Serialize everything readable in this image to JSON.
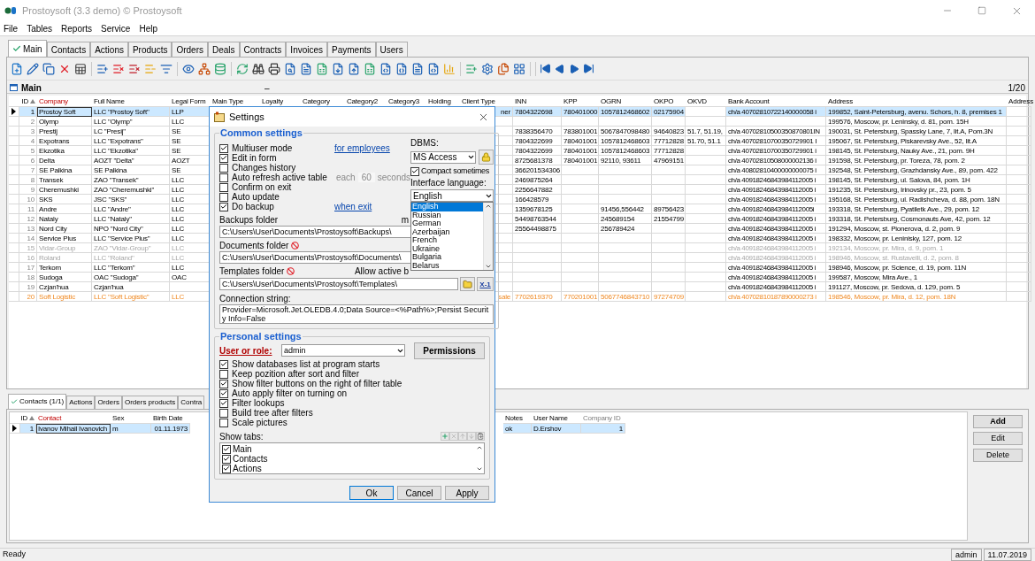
{
  "window": {
    "title": "Prostoysoft (3.3 demo) © Prostoysoft"
  },
  "menu": [
    "File",
    "Tables",
    "Reports",
    "Service",
    "Help"
  ],
  "tabs": [
    {
      "label": "Main",
      "selected": true
    },
    {
      "label": "Contacts",
      "selected": false
    },
    {
      "label": "Actions",
      "selected": false
    },
    {
      "label": "Products",
      "selected": false
    },
    {
      "label": "Orders",
      "selected": false
    },
    {
      "label": "Deals",
      "selected": false
    },
    {
      "label": "Contracts",
      "selected": false
    },
    {
      "label": "Invoices",
      "selected": false
    },
    {
      "label": "Payments",
      "selected": false
    },
    {
      "label": "Users",
      "selected": false
    }
  ],
  "main_panel": {
    "title": "Main",
    "marker": "–",
    "counter": "1/20"
  },
  "table": {
    "columns": [
      {
        "label": "ID",
        "kind": "normal",
        "sorted": true
      },
      {
        "label": "Company",
        "kind": "required",
        "sorted": false
      },
      {
        "label": "Full Name",
        "kind": "normal",
        "sorted": false
      },
      {
        "label": "Legal Form",
        "kind": "normal",
        "sorted": false
      },
      {
        "label": "Main Type",
        "kind": "normal",
        "sorted": false
      },
      {
        "label": "Loyalty",
        "kind": "normal",
        "sorted": false
      },
      {
        "label": "Category",
        "kind": "normal",
        "sorted": false
      },
      {
        "label": "Category2",
        "kind": "normal",
        "sorted": false
      },
      {
        "label": "Category3",
        "kind": "normal",
        "sorted": false
      },
      {
        "label": "Holding",
        "kind": "normal",
        "sorted": false
      },
      {
        "label": "Client Type",
        "kind": "normal",
        "sorted": false
      },
      {
        "label": "INN",
        "kind": "normal",
        "sorted": false
      },
      {
        "label": "KPP",
        "kind": "normal",
        "sorted": false
      },
      {
        "label": "OGRN",
        "kind": "normal",
        "sorted": false
      },
      {
        "label": "OKPO",
        "kind": "normal",
        "sorted": false
      },
      {
        "label": "OKVD",
        "kind": "normal",
        "sorted": false
      },
      {
        "label": "Bank Account",
        "kind": "normal",
        "sorted": false
      },
      {
        "label": "Address",
        "kind": "normal",
        "sorted": false
      },
      {
        "label": "Address",
        "kind": "normal",
        "sorted": false
      }
    ],
    "rows": [
      {
        "selected": true,
        "kind": "normal",
        "id": "1",
        "company": "Prostoy Soft",
        "full_name": "LLC \"Prostoy Soft\"",
        "legal_form": "LLP",
        "client_type": "ner",
        "inn": "7804322698",
        "kpp": "780401000",
        "ogrn": "1057812468602",
        "okpo": "02175904",
        "bank_account": "ch/a 40702810722140000058 i",
        "address": "199852, Saint-Petersburg, avenu. Schors, h. 8, premises 1"
      },
      {
        "selected": false,
        "kind": "normal",
        "id": "2",
        "company": "Olymp",
        "full_name": "LLC \"Olymp\"",
        "legal_form": "LLC",
        "address": "199576, Moscow, pr. Leninsky, d. 81, pom. 15H"
      },
      {
        "selected": false,
        "kind": "normal",
        "id": "3",
        "company": "Prestij",
        "full_name": "LC \"Presij\"",
        "legal_form": "SE",
        "inn": "7838356470",
        "kpp": "783801001",
        "ogrn": "5067847098480",
        "okpo": "94640823",
        "okvd": "51.7, 51.19,",
        "bank_account": "ch/a 40702810500350870801IN",
        "address": "190031, St. Petersburg, Spassky Lane, 7, lit.A, Pom.3N"
      },
      {
        "selected": false,
        "kind": "normal",
        "id": "4",
        "company": "Expotrans",
        "full_name": "LLC \"Expotrans\"",
        "legal_form": "SE",
        "inn": "7804322699",
        "kpp": "780401001",
        "ogrn": "1057812468603",
        "okpo": "77712828",
        "okvd": "51.70, 51.1",
        "bank_account": "ch/a 40702810700350729901 I",
        "address": "195067, St. Petersburg, Piskarevsky Ave., 52, lit.A"
      },
      {
        "selected": false,
        "kind": "normal",
        "id": "5",
        "company": "Ekzotika",
        "full_name": "LLC \"Ekzotika\"",
        "legal_form": "SE",
        "inn": "7804322699",
        "kpp": "780401001",
        "ogrn": "1057812468603",
        "okpo": "77712828",
        "bank_account": "ch/a 40702810700350729901 i",
        "address": "198145, St. Petersburg, Nauky Ave., 21, pom. 9H"
      },
      {
        "selected": false,
        "kind": "normal",
        "id": "6",
        "company": "Delta",
        "full_name": "AOZT \"Delta\"",
        "legal_form": "AOZT",
        "inn": "8725681378",
        "kpp": "780401001",
        "ogrn": "92110, 93611",
        "okpo": "47969151",
        "bank_account": "ch/a 40702810508000002136 i",
        "address": "191598, St. Petersburg, pr. Toreza, 78, pom. 2"
      },
      {
        "selected": false,
        "kind": "normal",
        "id": "7",
        "company": "SE Palkina",
        "full_name": "SE Palkina",
        "legal_form": "SE",
        "inn": "366201534306",
        "bank_account": "ch/a 40802810400000000075 i",
        "address": "192548, St. Petersburg, Grazhdansky Ave., 89, pom. 422"
      },
      {
        "selected": false,
        "kind": "normal",
        "id": "8",
        "company": "Transek",
        "full_name": "ZAO \"Transek\"",
        "legal_form": "LLC",
        "inn": "2469875264",
        "bank_account": "ch/a 40918246843984112005 i",
        "address": "198145, St. Petersburg, ul. Salova, 84, pom. 1H"
      },
      {
        "selected": false,
        "kind": "normal",
        "id": "9",
        "company": "Cheremushki",
        "full_name": "ZAO \"Cheremushki\"",
        "legal_form": "LLC",
        "inn": "2256647882",
        "bank_account": "ch/a 40918246843984112005 i",
        "address": "191235, St. Petersburg, Irinovsky pr., 23, pom. 5"
      },
      {
        "selected": false,
        "kind": "normal",
        "id": "10",
        "company": "SKS",
        "full_name": "JSC \"SKS\"",
        "legal_form": "LLC",
        "inn": "166428579",
        "bank_account": "ch/a 40918246843984112005 i",
        "address": "195168, St. Petersburg, ul. Radishcheva, d. 88, pom. 18N"
      },
      {
        "selected": false,
        "kind": "normal",
        "id": "11",
        "company": "Andre",
        "full_name": "LLC \"Andre\"",
        "legal_form": "LLC",
        "inn": "1359678125",
        "ogrn": "91456,556442",
        "okpo": "89756423",
        "bank_account": "ch/a 40918246843984112005i",
        "address": "193318, St. Petersburg, Pyatiletk Ave., 29, pom. 12"
      },
      {
        "selected": false,
        "kind": "normal",
        "id": "12",
        "company": "Nataly",
        "full_name": "LLC \"Nataly\"",
        "legal_form": "LLC",
        "inn": "54498763544",
        "ogrn": "245689154",
        "okpo": "21554799",
        "bank_account": "ch/a 40918246843984112005 i",
        "address": "193318, St. Petersburg, Cosmonauts Ave, 42, pom. 12"
      },
      {
        "selected": false,
        "kind": "normal",
        "id": "13",
        "company": "Nord City",
        "full_name": "NPO \"Nord City\"",
        "legal_form": "LLC",
        "inn": "25564498875",
        "ogrn": "256789424",
        "bank_account": "ch/a 40918246843984112005 i",
        "address": "191294, Moscow, st. Pionerova, d. 2, pom. 9"
      },
      {
        "selected": false,
        "kind": "normal",
        "id": "14",
        "company": "Service Plus",
        "full_name": "LLC \"Service Plus\"",
        "legal_form": "LLC",
        "bank_account": "ch/a 40918246843984112005 i",
        "address": "198332, Moscow, pr. Leninisky, 127, pom. 12"
      },
      {
        "selected": false,
        "kind": "inactive",
        "id": "15",
        "company": "Vidar-Group",
        "full_name": "ZAO \"Vidar-Group\"",
        "legal_form": "LLC",
        "bank_account": "ch/a 40918246843984112005 i",
        "address": "192134, Moscow, pr. Mira, d. 9, pom. 1"
      },
      {
        "selected": false,
        "kind": "inactive",
        "id": "16",
        "company": "Roland",
        "full_name": "LLC \"Roland\"",
        "legal_form": "LLC",
        "bank_account": "ch/a 40918246843984112005 i",
        "address": "198946, Moscow, st. Rustavelli, d. 2, pom. 8"
      },
      {
        "selected": false,
        "kind": "normal",
        "id": "17",
        "company": "Terkom",
        "full_name": "LLC \"Terkom\"",
        "legal_form": "LLC",
        "bank_account": "ch/a 40918246843984112005 i",
        "address": "198946, Moscow, pr. Science, d. 19, pom. 11N"
      },
      {
        "selected": false,
        "kind": "normal",
        "id": "18",
        "company": "Sudoga",
        "full_name": "OAC \"Sudoga\"",
        "legal_form": "OAC",
        "bank_account": "ch/a 40918246843984112005 i",
        "address": "199587, Moscow, Mira Ave., 1"
      },
      {
        "selected": false,
        "kind": "normal",
        "id": "19",
        "company": "Czjan'hua",
        "full_name": "Czjan'hua",
        "bank_account": "ch/a 40918246843984112005 i",
        "address": "191127, Moscow, pr. Sedova, d. 129, pom. 5"
      },
      {
        "selected": false,
        "kind": "accent",
        "id": "20",
        "company": "Soft Logistic",
        "full_name": "LLC \"Soft Logistic\"",
        "legal_form": "LLC",
        "client_type": "sale",
        "inn": "7702619370",
        "kpp": "770201001",
        "ogrn": "5067746843710",
        "okpo": "97274709",
        "bank_account": "ch/a 40702810187890000273 i",
        "address": "198546, Moscow, pr. Mira, d. 12, pom. 18N"
      }
    ]
  },
  "contacts": {
    "tabs": [
      {
        "label": "Contacts (1/1)",
        "selected": true
      },
      {
        "label": "Actions",
        "selected": false
      },
      {
        "label": "Orders",
        "selected": false
      },
      {
        "label": "Orders products",
        "selected": false
      },
      {
        "label": "Contra",
        "selected": false
      }
    ],
    "columns": [
      {
        "label": "ID",
        "kind": "normal",
        "sorted": true
      },
      {
        "label": "Contact",
        "kind": "required",
        "sorted": false
      },
      {
        "label": "Sex",
        "kind": "normal",
        "sorted": false
      },
      {
        "label": "Birth Date",
        "kind": "normal",
        "sorted": false
      },
      {
        "label": "Notes",
        "kind": "normal",
        "sorted": false
      },
      {
        "label": "User Name",
        "kind": "normal",
        "sorted": false
      },
      {
        "label": "Company ID",
        "kind": "readonly",
        "sorted": false
      }
    ],
    "rows": [
      {
        "selected": true,
        "id": "1",
        "contact": "Ivanov Mihail Ivanovich",
        "sex": "m",
        "birth_date": "01.11.1973",
        "notes": "ok",
        "user_name": "D.Ershov",
        "company_id": "1"
      }
    ],
    "buttons": [
      "Add",
      "Edit",
      "Delete"
    ]
  },
  "status_bar": {
    "text": "Ready",
    "user": "admin",
    "date": "11.07.2019"
  },
  "settings": {
    "title": "Settings",
    "common": {
      "legend": "Common settings",
      "options": [
        {
          "label": "Multiuser mode",
          "checked": true,
          "link": "for employees"
        },
        {
          "label": "Edit in form",
          "checked": true
        },
        {
          "label": "Changes history",
          "checked": false
        },
        {
          "label": "Auto refresh active table",
          "checked": false,
          "interval": {
            "prefix": "each",
            "value": "60",
            "suffix": "seconds",
            "disabled": true
          }
        },
        {
          "label": "Confirm on exit",
          "checked": false
        },
        {
          "label": "Auto update",
          "checked": false
        },
        {
          "label": "Do backup",
          "checked": true,
          "link": "when exit"
        }
      ],
      "dbms_label": "DBMS:",
      "dbms_value": "MS Access",
      "compact": {
        "label": "Compact sometimes",
        "checked": true
      },
      "language_label": "Interface language:",
      "language_value": "English",
      "language_options": [
        {
          "label": "English",
          "selected": true
        },
        {
          "label": "Russian",
          "selected": false
        },
        {
          "label": "German",
          "selected": false
        },
        {
          "label": "Azerbaijan",
          "selected": false
        },
        {
          "label": "French",
          "selected": false
        },
        {
          "label": "Ukraine",
          "selected": false
        },
        {
          "label": "Bulgaria",
          "selected": false
        },
        {
          "label": "Belarus",
          "selected": false
        }
      ],
      "backups_label": "Backups folder",
      "backups_note": "m",
      "backups_path": "C:\\Users\\User\\Documents\\Prostoysoft\\Backups\\",
      "documents_label": "Documents folder",
      "documents_path": "C:\\Users\\User\\Documents\\Prostoysoft\\Documents\\",
      "templates_label": "Templates folder",
      "templates_note": "Allow active b",
      "templates_path": "C:\\Users\\User\\Documents\\Prostoysoft\\Templates\\",
      "templates_button": "X-1",
      "connection_label": "Connection string:",
      "connection_string": "Provider=Microsoft.Jet.OLEDB.4.0;Data Source=<%Path%>;Persist Security Info=False"
    },
    "personal": {
      "legend": "Personal settings",
      "user_label": "User or role:",
      "user_value": "admin",
      "permissions": "Permissions",
      "options": [
        {
          "label": "Show databases list at program starts",
          "checked": true
        },
        {
          "label": "Keep pozition after sort and filter",
          "checked": false
        },
        {
          "label": "Show filter buttons on the right of filter table",
          "checked": true
        },
        {
          "label": "Auto apply filter on turning on",
          "checked": true
        },
        {
          "label": "Filter lookups",
          "checked": true
        },
        {
          "label": "Build tree after filters",
          "checked": false
        },
        {
          "label": "Scale pictures",
          "checked": false
        }
      ],
      "show_tabs_label": "Show tabs:",
      "show_tabs": [
        {
          "label": "Main",
          "checked": true
        },
        {
          "label": "Contacts",
          "checked": true
        },
        {
          "label": "Actions",
          "checked": true
        }
      ]
    },
    "buttons": [
      "Ok",
      "Cancel",
      "Apply"
    ]
  }
}
